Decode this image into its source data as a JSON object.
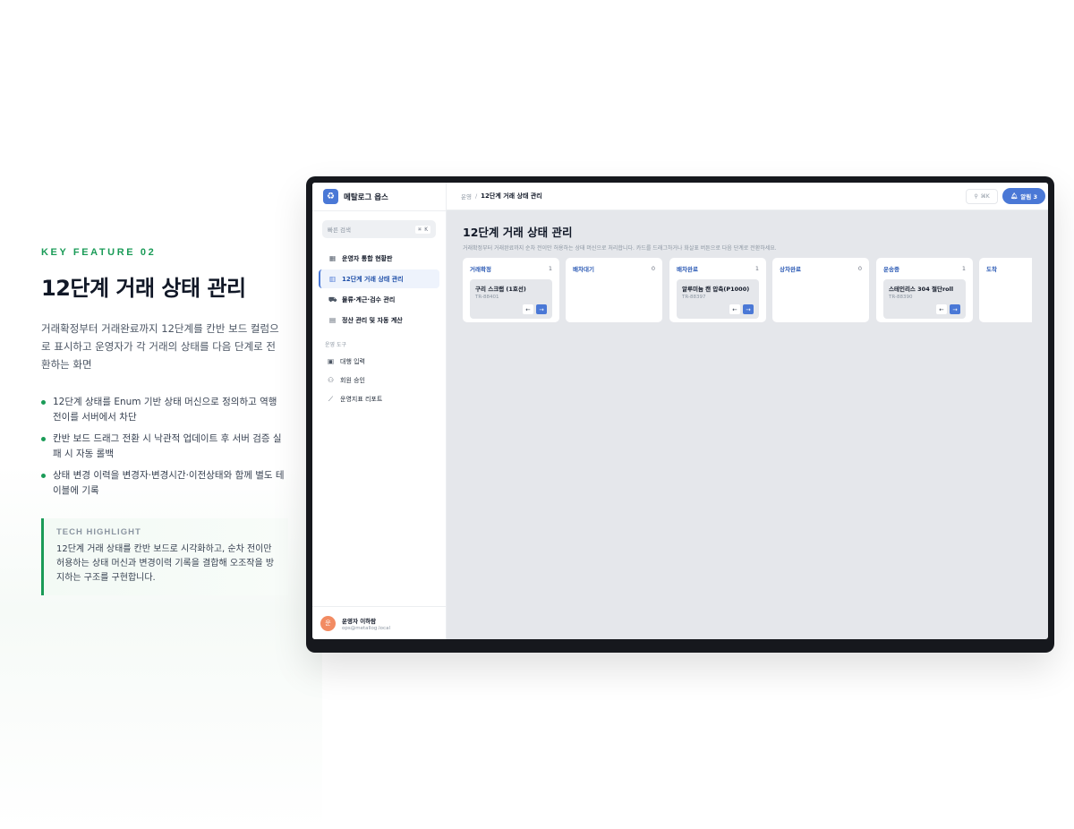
{
  "feature": {
    "eyebrow": "KEY FEATURE 02",
    "title": "12단계 거래 상태 관리",
    "description": "거래확정부터 거래완료까지 12단계를 칸반 보드 컬럼으로 표시하고 운영자가 각 거래의 상태를 다음 단계로 전환하는 화면",
    "bullets": [
      "12단계 상태를 Enum 기반 상태 머신으로 정의하고 역행 전이를 서버에서 차단",
      "칸반 보드 드래그 전환 시 낙관적 업데이트 후 서버 검증 실패 시 자동 롤백",
      "상태 변경 이력을 변경자·변경시간·이전상태와 함께 별도 테이블에 기록"
    ],
    "highlight_label": "TECH HIGHLIGHT",
    "highlight_text": "12단계 거래 상태를 칸반 보드로 시각화하고, 순차 전이만 허용하는 상태 머신과 변경이력 기록을 결합해 오조작을 방지하는 구조를 구현합니다."
  },
  "app": {
    "brand": "메탈로그 옵스",
    "quick_search": {
      "label": "빠른 검색",
      "shortcut": "⌘ K"
    },
    "nav": [
      {
        "label": "운영자 통합 현황판",
        "icon": "grid-icon"
      },
      {
        "label": "12단계 거래 상태 관리",
        "icon": "kanban-icon"
      },
      {
        "label": "물류·계근·검수 관리",
        "icon": "truck-icon"
      },
      {
        "label": "정산 관리 및 자동 계산",
        "icon": "calculator-icon"
      }
    ],
    "tools_label": "운영 도구",
    "tools": [
      {
        "label": "대행 입력",
        "icon": "clipboard-icon"
      },
      {
        "label": "회원 승인",
        "icon": "user-check-icon"
      },
      {
        "label": "운영지표 리포트",
        "icon": "chart-line-icon"
      }
    ],
    "user": {
      "avatar": "운",
      "name": "운영자 이하람",
      "email": "ops@metallog.local"
    },
    "breadcrumb": {
      "root": "운영",
      "sep": "/",
      "current": "12단계 거래 상태 관리"
    },
    "search_shortcut": "⌘K",
    "alert_label": "알림 3",
    "page_title": "12단계 거래 상태 관리",
    "page_subtitle": "거래확정부터 거래완료까지 순차 전이만 허용하는 상태 머신으로 처리합니다. 카드를 드래그하거나 화살표 버튼으로 다음 단계로 전환하세요.",
    "columns": [
      {
        "name": "거래확정",
        "count": "1",
        "cards": [
          {
            "title": "구리 스크랩 (1호선)",
            "id": "TR-88401"
          }
        ]
      },
      {
        "name": "배차대기",
        "count": "0",
        "cards": []
      },
      {
        "name": "배차완료",
        "count": "1",
        "cards": [
          {
            "title": "알루미늄 캔 압축(P1000)",
            "id": "TR-88397"
          }
        ]
      },
      {
        "name": "상차완료",
        "count": "0",
        "cards": []
      },
      {
        "name": "운송중",
        "count": "1",
        "cards": [
          {
            "title": "스테인리스 304 절단roll",
            "id": "TR-88390"
          }
        ]
      },
      {
        "name": "도착",
        "count": "",
        "cards": []
      }
    ],
    "colors": {
      "accent": "#4a78d6",
      "brand_green": "#1a9b57"
    }
  }
}
